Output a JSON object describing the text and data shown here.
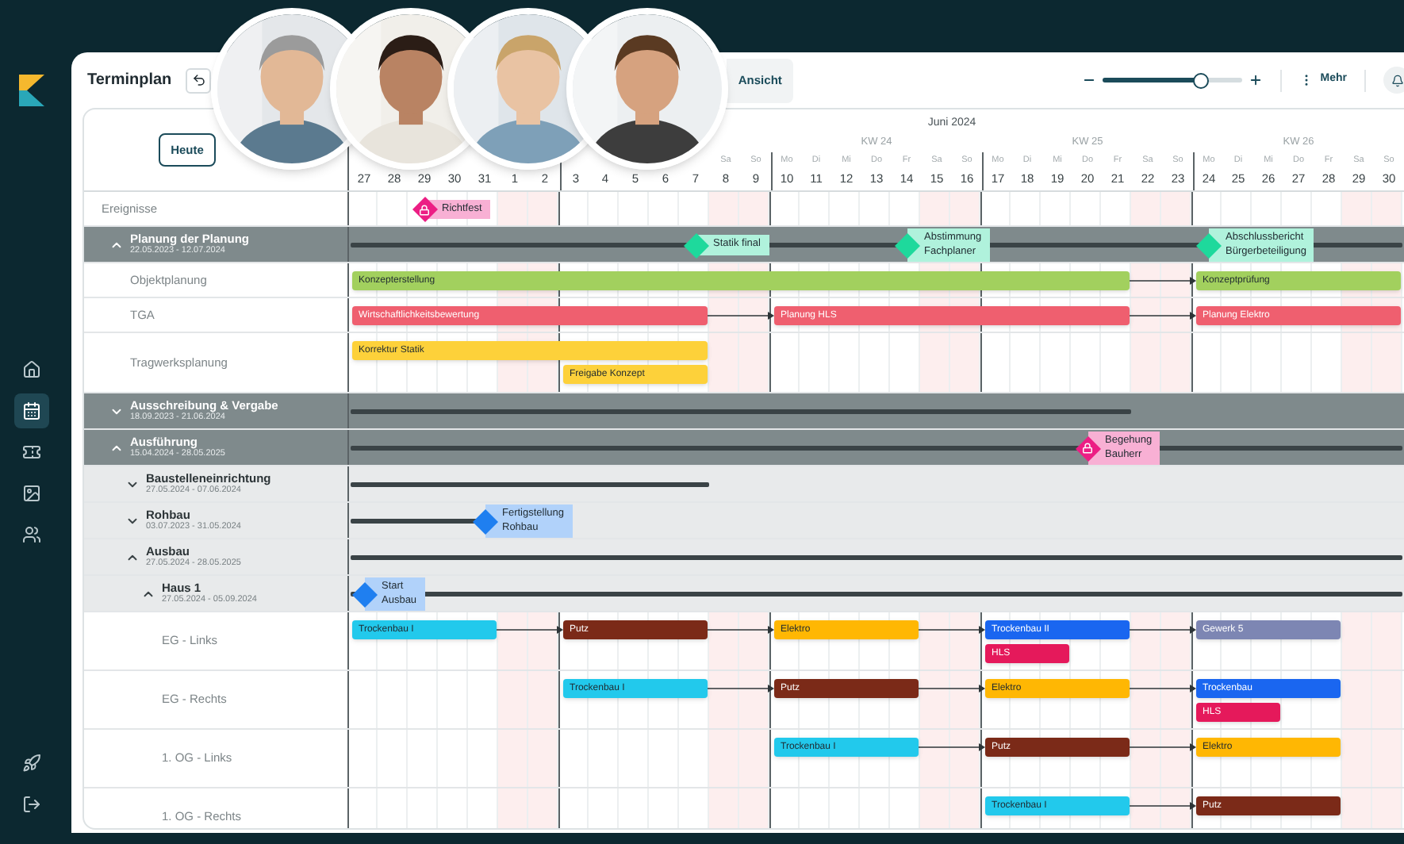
{
  "nav": [
    {
      "kind": "home",
      "selected": false
    },
    {
      "kind": "calendar",
      "selected": true
    },
    {
      "kind": "ticket",
      "selected": false
    },
    {
      "kind": "image",
      "selected": false
    },
    {
      "kind": "users",
      "selected": false
    }
  ],
  "bottom_nav": [
    {
      "kind": "rocket"
    },
    {
      "kind": "logout"
    }
  ],
  "header": {
    "title": "Terminplan",
    "view_button": "Ansicht",
    "zoom": {
      "level": 0.7
    },
    "more_button": "Mehr"
  },
  "today_button": "Heute",
  "timeline": {
    "months": [
      {
        "label": "Juni 2024"
      }
    ],
    "weeks": [
      {
        "label": "KW 24"
      },
      {
        "label": "KW 25"
      },
      {
        "label": "KW 26"
      }
    ],
    "days": [
      {
        "number": "27",
        "weekend": false
      },
      {
        "number": "28",
        "weekend": false
      },
      {
        "number": "29",
        "weekend": false
      },
      {
        "number": "30",
        "weekend": false
      },
      {
        "number": "31",
        "weekend": false
      },
      {
        "number": "1",
        "weekend": true
      },
      {
        "number": "2",
        "weekend": true
      },
      {
        "number": "3",
        "weekend": false
      },
      {
        "number": "4",
        "weekend": false
      },
      {
        "number": "5",
        "weekend": false
      },
      {
        "number": "6",
        "weekend": false
      },
      {
        "number": "7",
        "weekend": false
      },
      {
        "name": "Sa",
        "number": "8",
        "weekend": true
      },
      {
        "name": "So",
        "number": "9",
        "weekend": true
      },
      {
        "name": "Mo",
        "number": "10",
        "weekend": false
      },
      {
        "name": "Di",
        "number": "11",
        "weekend": false
      },
      {
        "name": "Mi",
        "number": "12",
        "weekend": false
      },
      {
        "name": "Do",
        "number": "13",
        "weekend": false
      },
      {
        "name": "Fr",
        "number": "14",
        "weekend": false
      },
      {
        "name": "Sa",
        "number": "15",
        "weekend": true
      },
      {
        "name": "So",
        "number": "16",
        "weekend": true
      },
      {
        "name": "Mo",
        "number": "17",
        "weekend": false
      },
      {
        "name": "Di",
        "number": "18",
        "weekend": false
      },
      {
        "name": "Mi",
        "number": "19",
        "weekend": false
      },
      {
        "name": "Do",
        "number": "20",
        "weekend": false
      },
      {
        "name": "Fr",
        "number": "21",
        "weekend": false
      },
      {
        "name": "Sa",
        "number": "22",
        "weekend": true
      },
      {
        "name": "So",
        "number": "23",
        "weekend": true
      },
      {
        "name": "Mo",
        "number": "24",
        "weekend": false
      },
      {
        "name": "Di",
        "number": "25",
        "weekend": false
      },
      {
        "name": "Mi",
        "number": "26",
        "weekend": false
      },
      {
        "name": "Do",
        "number": "27",
        "weekend": false
      },
      {
        "name": "Fr",
        "number": "28",
        "weekend": false
      },
      {
        "name": "Sa",
        "number": "29",
        "weekend": true
      },
      {
        "name": "So",
        "number": "30",
        "weekend": true
      }
    ]
  },
  "rows": [
    {
      "kind": "events",
      "label": "Ereignisse",
      "milestones": [
        {
          "label": "Richtfest",
          "color": "#ec1e84",
          "locked": true
        }
      ]
    },
    {
      "kind": "group",
      "label": "Planung der Planung",
      "dates": "22.05.2023 - 12.07.2024",
      "expanded": true,
      "milestones": [
        {
          "label": "Statik final",
          "color": "#1ed99c",
          "locked": false
        },
        {
          "label": "Abstimmung\nFachplaner",
          "color": "#1ed99c",
          "locked": false
        },
        {
          "label": "Abschlussbericht\nBürgerbeteiligung",
          "color": "#1ed99c",
          "locked": false
        }
      ],
      "children": [
        {
          "kind": "task",
          "label": "Objektplanung",
          "lanes": [
            {
              "bars": [
                {
                  "label": "Konzepterstellung",
                  "color": "#a2d05e"
                },
                {
                  "label": "Konzeptprüfung",
                  "color": "#a2d05e"
                }
              ]
            }
          ]
        },
        {
          "kind": "task",
          "label": "TGA",
          "lanes": [
            {
              "bars": [
                {
                  "label": "Wirtschaftlichkeitsbewertung",
                  "color": "#ef5f6f"
                },
                {
                  "label": "Planung HLS",
                  "color": "#ef5f6f"
                },
                {
                  "label": "Planung Elektro",
                  "color": "#ef5f6f"
                }
              ]
            }
          ]
        },
        {
          "kind": "task",
          "label": "Tragwerksplanung",
          "lanes": [
            {
              "bars": [
                {
                  "label": "Korrektur Statik",
                  "color": "#fdd13a"
                }
              ]
            },
            {
              "bars": [
                {
                  "label": "Freigabe Konzept",
                  "color": "#fdd13a"
                }
              ]
            }
          ]
        }
      ]
    },
    {
      "kind": "group",
      "label": "Ausschreibung & Vergabe",
      "dates": "18.09.2023 - 21.06.2024",
      "expanded": false
    },
    {
      "kind": "group",
      "label": "Ausführung",
      "dates": "15.04.2024 - 28.05.2025",
      "expanded": true,
      "milestones": [
        {
          "label": "Begehung\nBauherr",
          "color": "#ec1e84",
          "locked": true
        }
      ],
      "children": [
        {
          "kind": "subgroup",
          "label": "Baustelleneinrichtung",
          "dates": "27.05.2024 - 07.06.2024",
          "expanded": false
        },
        {
          "kind": "subgroup",
          "label": "Rohbau",
          "dates": "03.07.2023 - 31.05.2024",
          "expanded": false,
          "milestones": [
            {
              "label": "Fertigstellung\nRohbau",
              "color": "#1f7ff0",
              "locked": false
            }
          ]
        },
        {
          "kind": "subgroup",
          "label": "Ausbau",
          "dates": "27.05.2024 - 28.05.2025",
          "expanded": true,
          "children": [
            {
              "kind": "subgroup",
              "label": "Haus 1",
              "dates": "27.05.2024 - 05.09.2024",
              "expanded": true,
              "milestones": [
                {
                  "label": "Start\nAusbau",
                  "color": "#1f7ff0",
                  "locked": false
                }
              ],
              "children": [
                {
                  "kind": "task",
                  "label": "EG - Links",
                  "lanes": [
                    {
                      "bars": [
                        {
                          "label": "Trockenbau I",
                          "color": "#22c9ec"
                        },
                        {
                          "label": "Putz",
                          "color": "#7b2a18"
                        },
                        {
                          "label": "Elektro",
                          "color": "#ffb703"
                        },
                        {
                          "label": "Trockenbau II",
                          "color": "#1a66f0"
                        },
                        {
                          "label": "Gewerk 5",
                          "color": "#7d86b3"
                        }
                      ]
                    },
                    {
                      "bars": [
                        {
                          "label": "HLS",
                          "color": "#e5195b"
                        }
                      ]
                    }
                  ]
                },
                {
                  "kind": "task",
                  "label": "EG - Rechts",
                  "lanes": [
                    {
                      "bars": [
                        {
                          "label": "Trockenbau I",
                          "color": "#22c9ec"
                        },
                        {
                          "label": "Putz",
                          "color": "#7b2a18"
                        },
                        {
                          "label": "Elektro",
                          "color": "#ffb703"
                        },
                        {
                          "label": "Trockenbau",
                          "color": "#1a66f0"
                        }
                      ]
                    },
                    {
                      "bars": [
                        {
                          "label": "HLS",
                          "color": "#e5195b"
                        }
                      ]
                    }
                  ]
                },
                {
                  "kind": "task",
                  "label": "1. OG - Links",
                  "lanes": [
                    {
                      "bars": [
                        {
                          "label": "Trockenbau I",
                          "color": "#22c9ec"
                        },
                        {
                          "label": "Putz",
                          "color": "#7b2a18"
                        },
                        {
                          "label": "Elektro",
                          "color": "#ffb703"
                        }
                      ]
                    }
                  ]
                },
                {
                  "kind": "task",
                  "label": "1. OG - Rechts",
                  "lanes": [
                    {
                      "bars": [
                        {
                          "label": "Trockenbau I",
                          "color": "#22c9ec"
                        },
                        {
                          "label": "Putz",
                          "color": "#7b2a18"
                        }
                      ]
                    }
                  ]
                }
              ]
            }
          ]
        }
      ]
    }
  ]
}
